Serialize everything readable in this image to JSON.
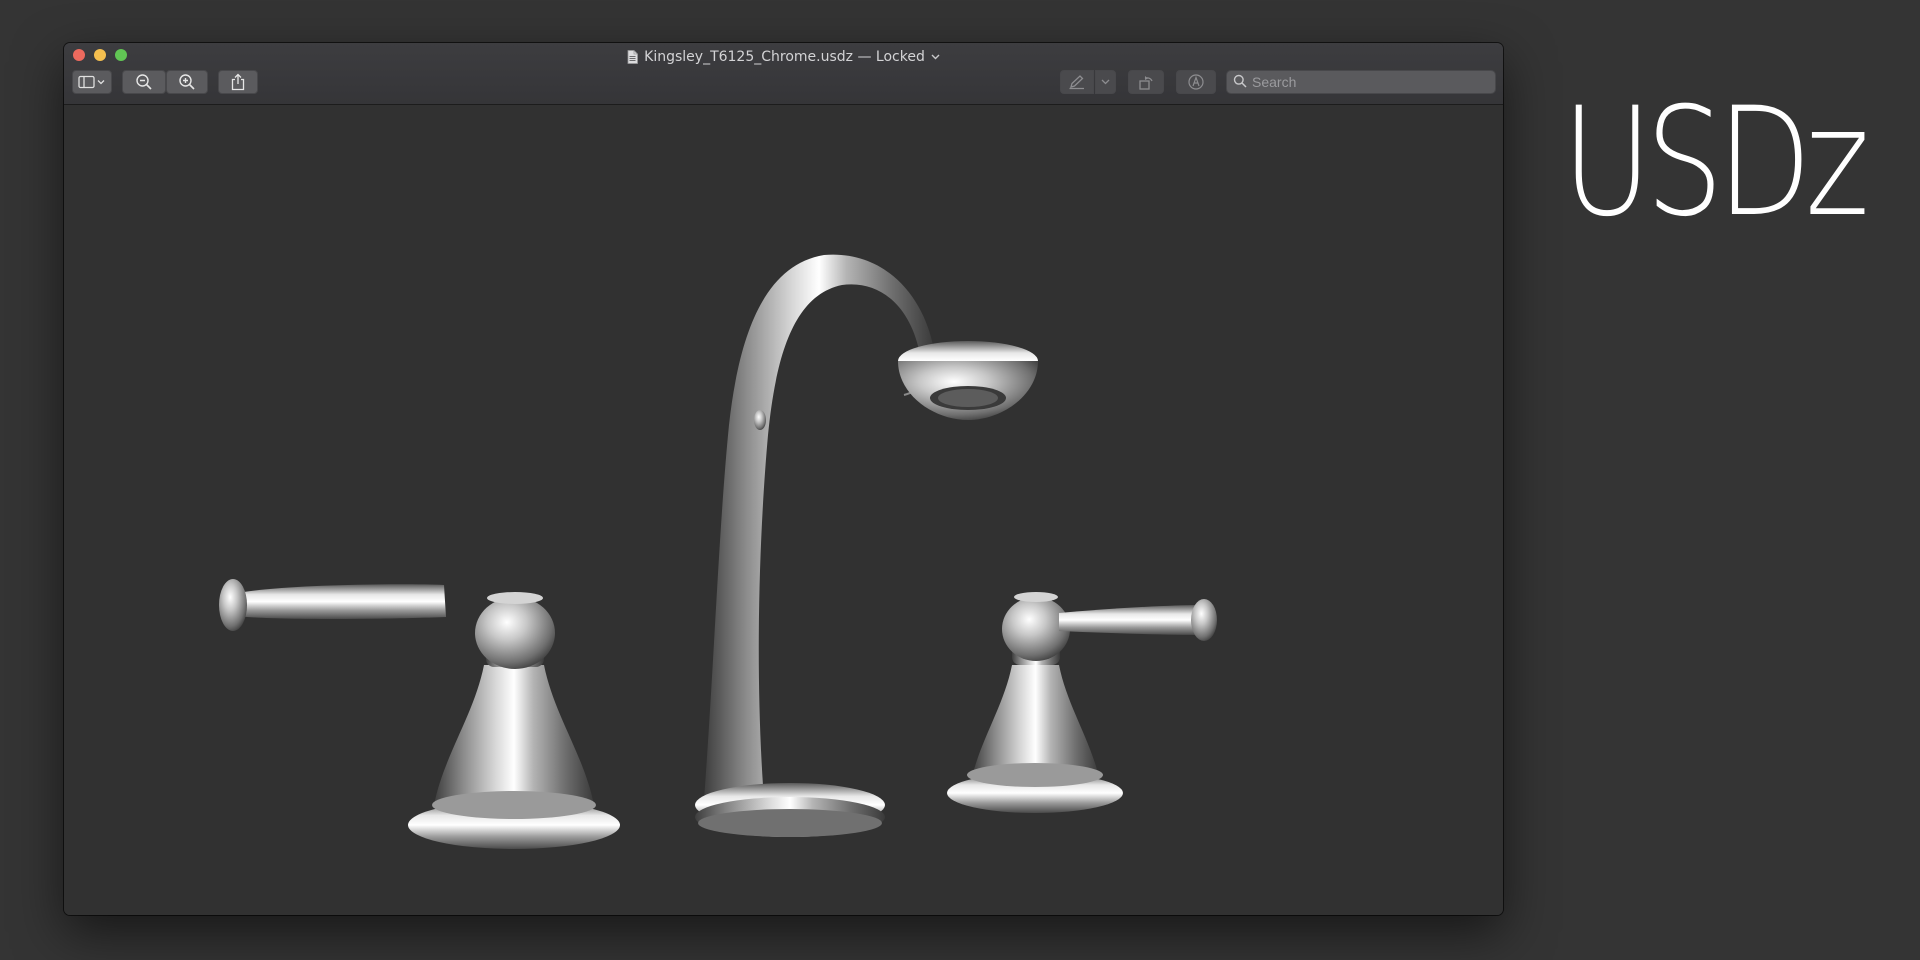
{
  "window": {
    "title": "Kingsley_T6125_Chrome.usdz — Locked",
    "file_icon": "document-icon",
    "title_chevron": "⌄"
  },
  "toolbar": {
    "sidebar_icon": "sidebar-icon",
    "zoom_out_icon": "zoom-out-icon",
    "zoom_in_icon": "zoom-in-icon",
    "share_icon": "share-icon",
    "markup_icon": "pen-icon",
    "rotate_icon": "rotate-icon",
    "annotate_icon": "markup-circle-icon"
  },
  "search": {
    "placeholder": "Search",
    "icon": "search-icon"
  },
  "viewer": {
    "content": "3d-model-faucet"
  },
  "brand": {
    "label": "USDz"
  },
  "colors": {
    "background": "#343434",
    "window": "#313131",
    "close": "#ed6a5e",
    "minimize": "#f4bf4f",
    "zoom": "#61c554"
  }
}
